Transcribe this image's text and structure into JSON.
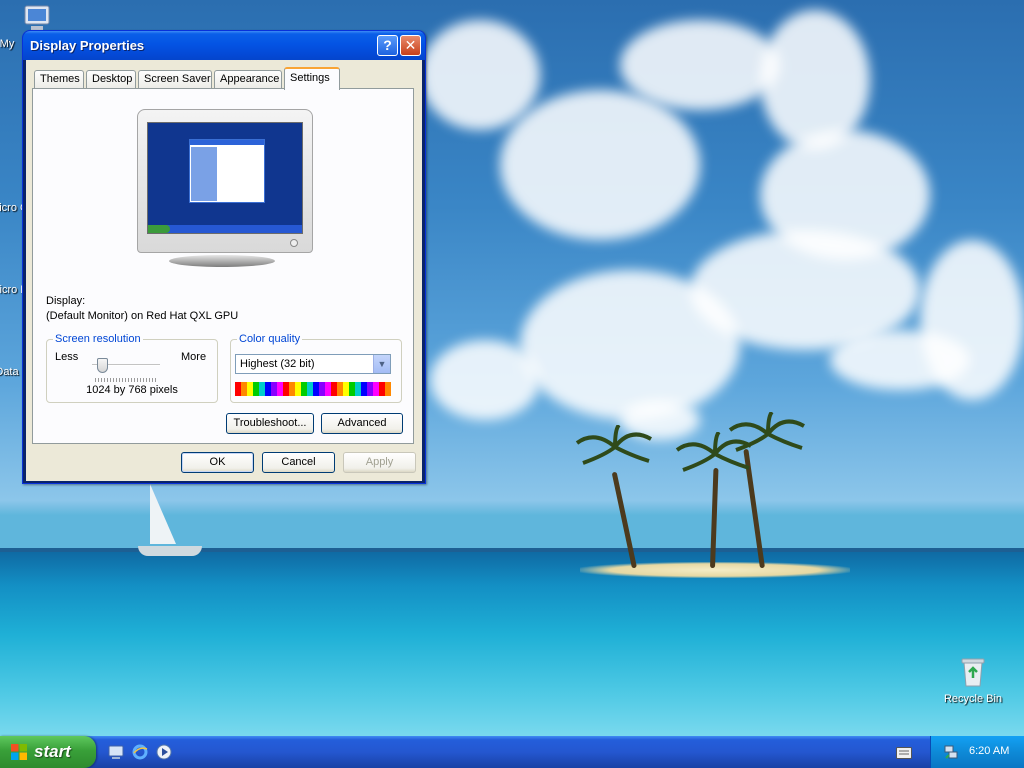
{
  "window": {
    "title": "Display Properties",
    "help_button": "?",
    "close_button": "✕",
    "tabs": [
      {
        "label": "Themes"
      },
      {
        "label": "Desktop"
      },
      {
        "label": "Screen Saver"
      },
      {
        "label": "Appearance"
      },
      {
        "label": "Settings",
        "active": true
      }
    ]
  },
  "settings": {
    "display_label": "Display:",
    "display_value": "(Default Monitor) on Red Hat QXL GPU",
    "resolution": {
      "title": "Screen resolution",
      "less": "Less",
      "more": "More",
      "value": "1024 by 768 pixels"
    },
    "color_quality": {
      "title": "Color quality",
      "selected": "Highest (32 bit)"
    },
    "troubleshoot_button": "Troubleshoot...",
    "advanced_button": "Advanced"
  },
  "footer": {
    "ok": "OK",
    "cancel": "Cancel",
    "apply": "Apply"
  },
  "desktop_icons": [
    {
      "label": "My",
      "icon": "computer-icon"
    },
    {
      "label": "Micro C",
      "icon": "shortcut-icon"
    },
    {
      "label": "Micro B",
      "icon": "shortcut-icon"
    },
    {
      "label": "Data",
      "icon": "shortcut-icon"
    },
    {
      "label": "Recycle Bin",
      "icon": "recycle-bin-icon"
    }
  ],
  "taskbar": {
    "start": "start",
    "quick_launch": [
      "show-desktop-icon",
      "internet-explorer-icon",
      "media-player-icon"
    ],
    "clock": "6:20 AM"
  },
  "colors": {
    "titlebar": "#0454e4",
    "window_face": "#ece9d8",
    "group_title": "#0046d5",
    "active_tab_accent": "#f9a434",
    "start_green": "#39a039",
    "taskbar_blue": "#245edb"
  }
}
